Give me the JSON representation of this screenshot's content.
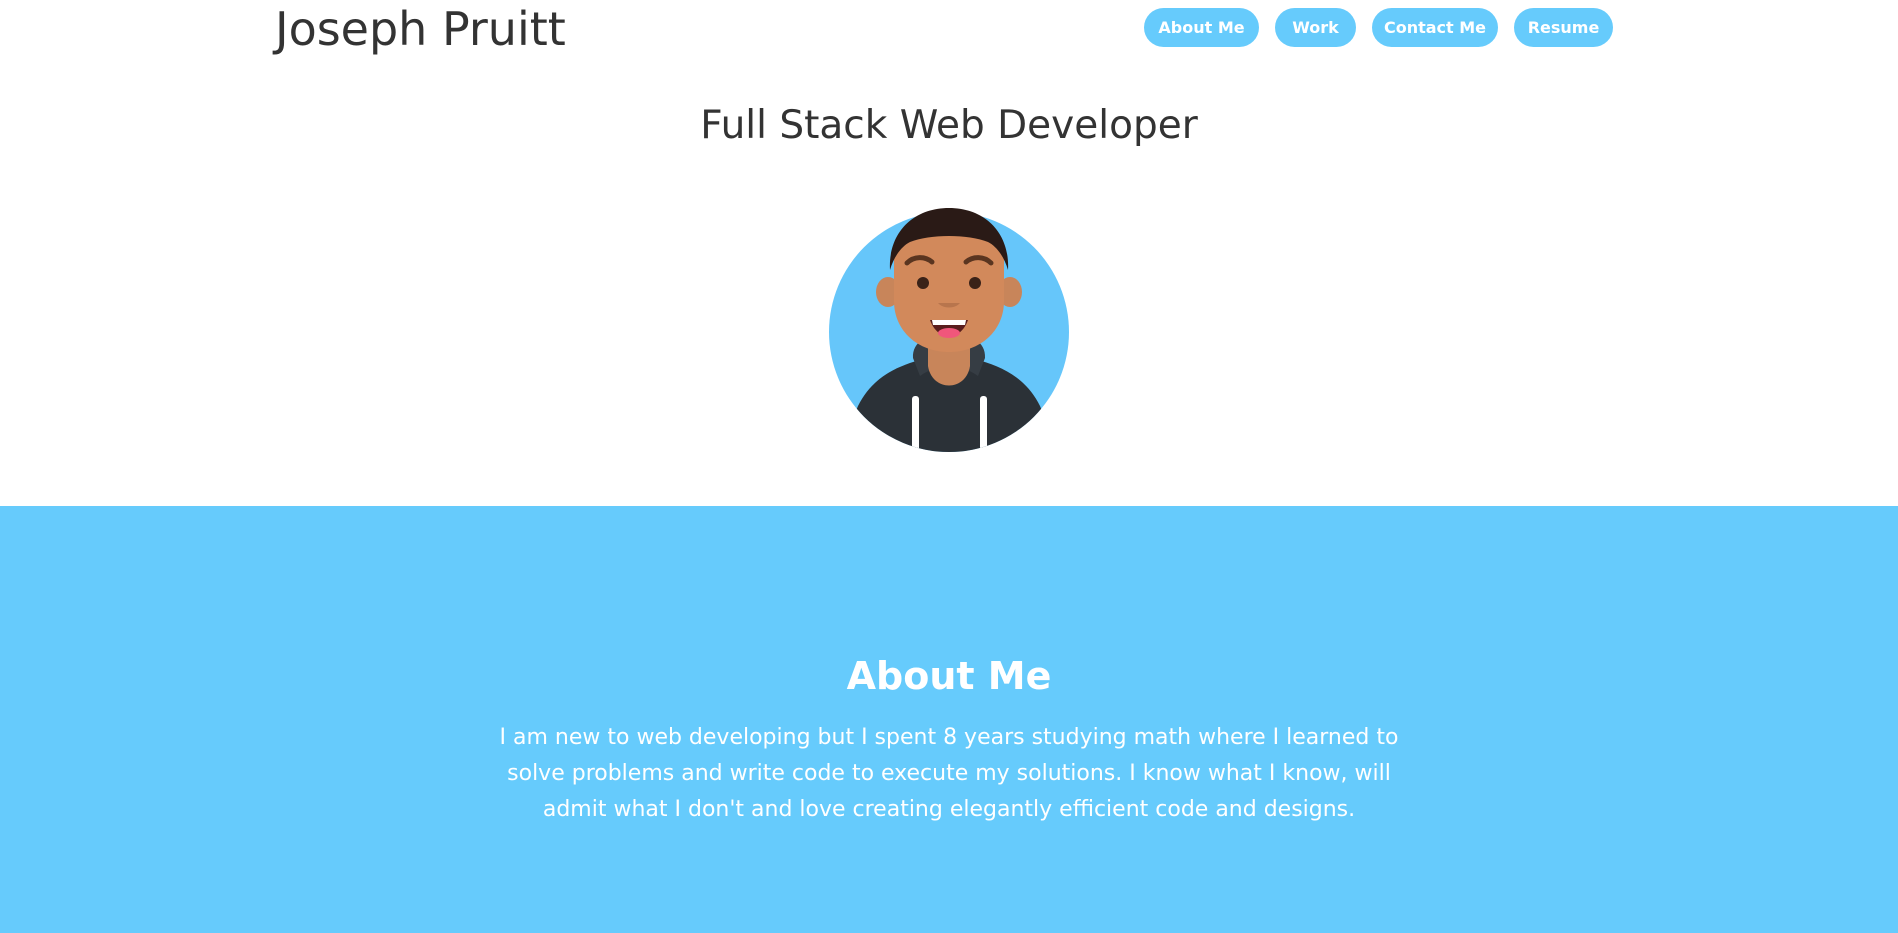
{
  "header": {
    "brand": "Joseph Pruitt",
    "nav": [
      {
        "label": "About Me"
      },
      {
        "label": "Work"
      },
      {
        "label": "Contact Me"
      },
      {
        "label": "Resume"
      }
    ]
  },
  "hero": {
    "title": "Full Stack Web Developer",
    "avatar_icon": "avatar-illustration"
  },
  "about": {
    "title": "About Me",
    "text": "I am new to web developing but I spent 8 years studying math where I learned to solve problems and write code to execute my solutions. I know what I know, will admit what I don't and love creating elegantly efficient code and designs."
  },
  "colors": {
    "accent": "#66cbfc",
    "text_dark": "#333333",
    "text_light": "#ffffff"
  }
}
